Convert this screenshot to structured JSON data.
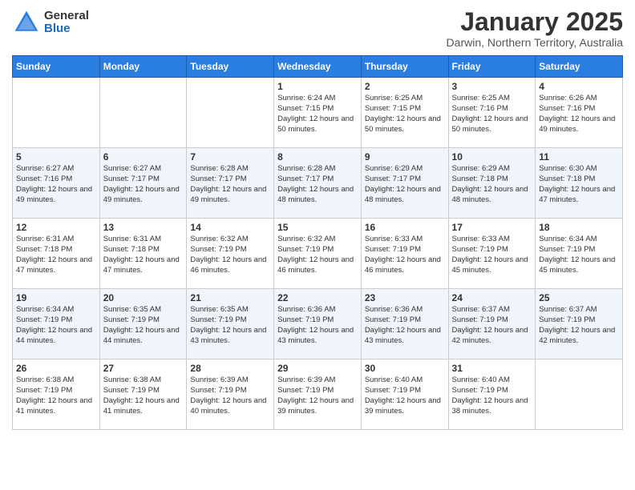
{
  "header": {
    "logo_general": "General",
    "logo_blue": "Blue",
    "title": "January 2025",
    "subtitle": "Darwin, Northern Territory, Australia"
  },
  "weekdays": [
    "Sunday",
    "Monday",
    "Tuesday",
    "Wednesday",
    "Thursday",
    "Friday",
    "Saturday"
  ],
  "weeks": [
    [
      {
        "day": "",
        "info": ""
      },
      {
        "day": "",
        "info": ""
      },
      {
        "day": "",
        "info": ""
      },
      {
        "day": "1",
        "info": "Sunrise: 6:24 AM\nSunset: 7:15 PM\nDaylight: 12 hours\nand 50 minutes."
      },
      {
        "day": "2",
        "info": "Sunrise: 6:25 AM\nSunset: 7:15 PM\nDaylight: 12 hours\nand 50 minutes."
      },
      {
        "day": "3",
        "info": "Sunrise: 6:25 AM\nSunset: 7:16 PM\nDaylight: 12 hours\nand 50 minutes."
      },
      {
        "day": "4",
        "info": "Sunrise: 6:26 AM\nSunset: 7:16 PM\nDaylight: 12 hours\nand 49 minutes."
      }
    ],
    [
      {
        "day": "5",
        "info": "Sunrise: 6:27 AM\nSunset: 7:16 PM\nDaylight: 12 hours\nand 49 minutes."
      },
      {
        "day": "6",
        "info": "Sunrise: 6:27 AM\nSunset: 7:17 PM\nDaylight: 12 hours\nand 49 minutes."
      },
      {
        "day": "7",
        "info": "Sunrise: 6:28 AM\nSunset: 7:17 PM\nDaylight: 12 hours\nand 49 minutes."
      },
      {
        "day": "8",
        "info": "Sunrise: 6:28 AM\nSunset: 7:17 PM\nDaylight: 12 hours\nand 48 minutes."
      },
      {
        "day": "9",
        "info": "Sunrise: 6:29 AM\nSunset: 7:17 PM\nDaylight: 12 hours\nand 48 minutes."
      },
      {
        "day": "10",
        "info": "Sunrise: 6:29 AM\nSunset: 7:18 PM\nDaylight: 12 hours\nand 48 minutes."
      },
      {
        "day": "11",
        "info": "Sunrise: 6:30 AM\nSunset: 7:18 PM\nDaylight: 12 hours\nand 47 minutes."
      }
    ],
    [
      {
        "day": "12",
        "info": "Sunrise: 6:31 AM\nSunset: 7:18 PM\nDaylight: 12 hours\nand 47 minutes."
      },
      {
        "day": "13",
        "info": "Sunrise: 6:31 AM\nSunset: 7:18 PM\nDaylight: 12 hours\nand 47 minutes."
      },
      {
        "day": "14",
        "info": "Sunrise: 6:32 AM\nSunset: 7:19 PM\nDaylight: 12 hours\nand 46 minutes."
      },
      {
        "day": "15",
        "info": "Sunrise: 6:32 AM\nSunset: 7:19 PM\nDaylight: 12 hours\nand 46 minutes."
      },
      {
        "day": "16",
        "info": "Sunrise: 6:33 AM\nSunset: 7:19 PM\nDaylight: 12 hours\nand 46 minutes."
      },
      {
        "day": "17",
        "info": "Sunrise: 6:33 AM\nSunset: 7:19 PM\nDaylight: 12 hours\nand 45 minutes."
      },
      {
        "day": "18",
        "info": "Sunrise: 6:34 AM\nSunset: 7:19 PM\nDaylight: 12 hours\nand 45 minutes."
      }
    ],
    [
      {
        "day": "19",
        "info": "Sunrise: 6:34 AM\nSunset: 7:19 PM\nDaylight: 12 hours\nand 44 minutes."
      },
      {
        "day": "20",
        "info": "Sunrise: 6:35 AM\nSunset: 7:19 PM\nDaylight: 12 hours\nand 44 minutes."
      },
      {
        "day": "21",
        "info": "Sunrise: 6:35 AM\nSunset: 7:19 PM\nDaylight: 12 hours\nand 43 minutes."
      },
      {
        "day": "22",
        "info": "Sunrise: 6:36 AM\nSunset: 7:19 PM\nDaylight: 12 hours\nand 43 minutes."
      },
      {
        "day": "23",
        "info": "Sunrise: 6:36 AM\nSunset: 7:19 PM\nDaylight: 12 hours\nand 43 minutes."
      },
      {
        "day": "24",
        "info": "Sunrise: 6:37 AM\nSunset: 7:19 PM\nDaylight: 12 hours\nand 42 minutes."
      },
      {
        "day": "25",
        "info": "Sunrise: 6:37 AM\nSunset: 7:19 PM\nDaylight: 12 hours\nand 42 minutes."
      }
    ],
    [
      {
        "day": "26",
        "info": "Sunrise: 6:38 AM\nSunset: 7:19 PM\nDaylight: 12 hours\nand 41 minutes."
      },
      {
        "day": "27",
        "info": "Sunrise: 6:38 AM\nSunset: 7:19 PM\nDaylight: 12 hours\nand 41 minutes."
      },
      {
        "day": "28",
        "info": "Sunrise: 6:39 AM\nSunset: 7:19 PM\nDaylight: 12 hours\nand 40 minutes."
      },
      {
        "day": "29",
        "info": "Sunrise: 6:39 AM\nSunset: 7:19 PM\nDaylight: 12 hours\nand 39 minutes."
      },
      {
        "day": "30",
        "info": "Sunrise: 6:40 AM\nSunset: 7:19 PM\nDaylight: 12 hours\nand 39 minutes."
      },
      {
        "day": "31",
        "info": "Sunrise: 6:40 AM\nSunset: 7:19 PM\nDaylight: 12 hours\nand 38 minutes."
      },
      {
        "day": "",
        "info": ""
      }
    ]
  ]
}
